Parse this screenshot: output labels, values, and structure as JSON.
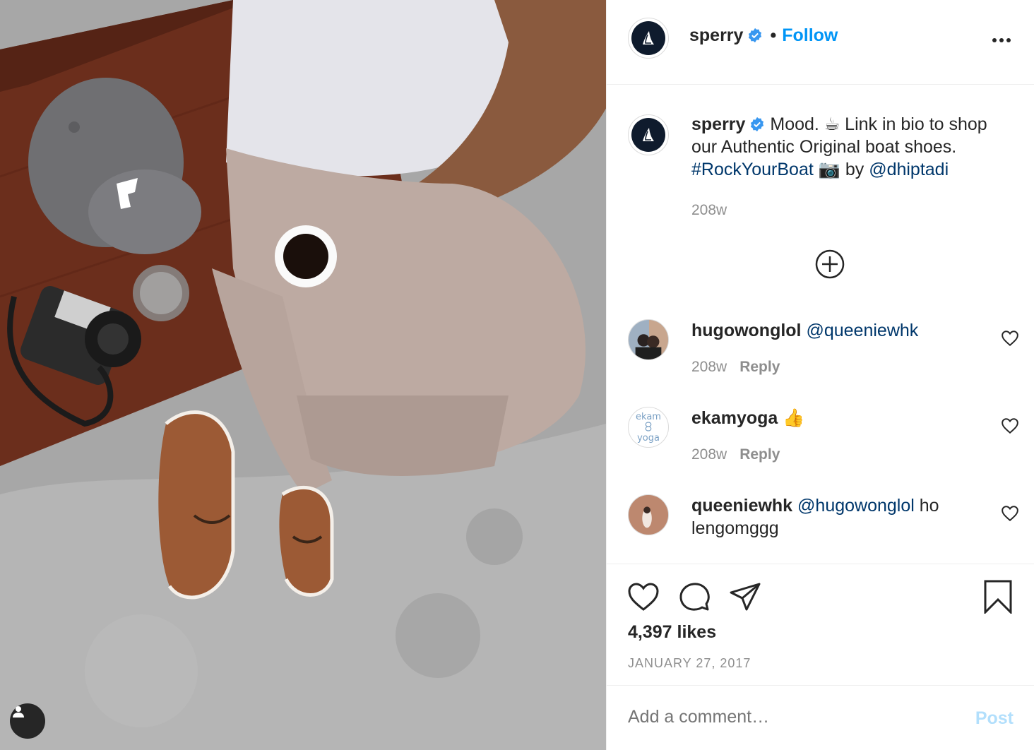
{
  "post": {
    "username": "sperry",
    "follow_label": "Follow",
    "separator": "•",
    "more_icon": "more-horizontal-icon"
  },
  "caption": {
    "username": "sperry",
    "text_part1": " Mood. ☕ Link in bio to shop our Authentic Original boat shoes. ",
    "hashtag": "#RockYourBoat",
    "text_part2": " 📷 by ",
    "mention": "@dhiptadi",
    "age": "208w"
  },
  "comments": [
    {
      "username": "hugowonglol",
      "mention": "@queeniewhk",
      "text": "",
      "age": "208w",
      "reply_label": "Reply"
    },
    {
      "username": "ekamyoga",
      "mention": "",
      "text": " 👍",
      "age": "208w",
      "reply_label": "Reply"
    },
    {
      "username": "queeniewhk",
      "mention": "@hugowonglol",
      "text": " ho lengomggg",
      "age": "",
      "reply_label": ""
    }
  ],
  "ekam_avatar": {
    "line1": "ekam",
    "line2": "yoga"
  },
  "stats": {
    "likes": "4,397 likes",
    "date": "JANUARY 27, 2017"
  },
  "add_comment": {
    "placeholder": "Add a comment…",
    "post_label": "Post"
  },
  "colors": {
    "accent": "#0095f6",
    "link": "#00376b",
    "muted": "#8e8e8e",
    "post_disabled": "#b2dffc",
    "verified": "#3897f0"
  }
}
